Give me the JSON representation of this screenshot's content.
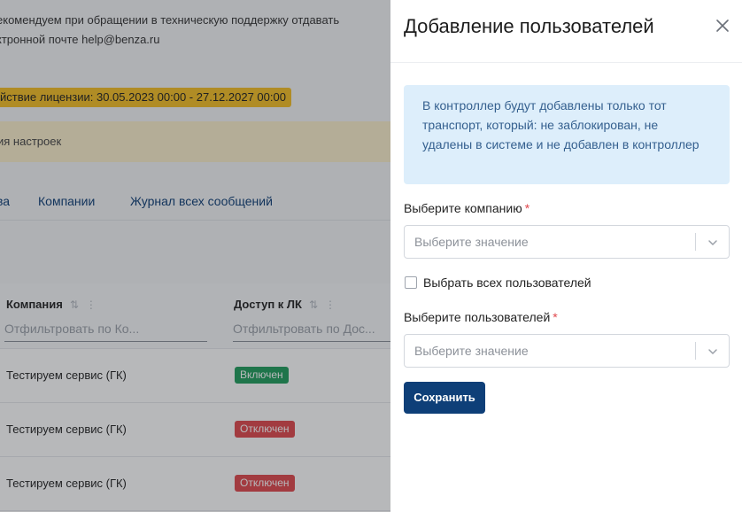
{
  "background": {
    "notice_line1": "екомендуем при обращении в техническую поддержку отдавать",
    "notice_line2": "ктронной почте help@benza.ru",
    "license": "йствие лицензии: 30.05.2023 00:00 - 27.12.2027 00:00",
    "warning": "ия настроек",
    "tabs": [
      "ва",
      "Компании",
      "Журнал всех сообщений"
    ],
    "table": {
      "columns": [
        {
          "title": "Компания",
          "filter_placeholder": "Отфильтровать по Ко..."
        },
        {
          "title": "Доступ к ЛК",
          "filter_placeholder": "Отфильтровать по Дос..."
        }
      ],
      "rows": [
        {
          "company": "Тестируем сервис (ГК)",
          "access": "Включен",
          "status": "on"
        },
        {
          "company": "Тестируем сервис (ГК)",
          "access": "Отключен",
          "status": "off"
        },
        {
          "company": "Тестируем сервис (ГК)",
          "access": "Отключен",
          "status": "off"
        }
      ]
    }
  },
  "drawer": {
    "title": "Добавление пользователей",
    "info": "В контроллер будут добавлены только тот транспорт, который: не заблокирован, не удалены в системе и не добавлен в контроллер",
    "company_label": "Выберите компанию",
    "company_placeholder": "Выберите значение",
    "select_all_label": "Выбрать всех пользователей",
    "users_label": "Выберите пользователей",
    "users_placeholder": "Выберите значение",
    "save_label": "Сохранить",
    "required_mark": "*"
  },
  "icons": {
    "close": "close-icon",
    "chevron": "chevron-down-icon",
    "sort": "sort-icon",
    "menu": "column-menu-icon"
  },
  "colors": {
    "primary": "#0e3f78",
    "info_bg": "#ddeefb",
    "info_text": "#35608f",
    "license_bg": "#f5bf24",
    "warning_bg": "#fbefcc",
    "badge_on": "#1f9d5c",
    "badge_off": "#e0474c",
    "required": "#e0474c"
  }
}
